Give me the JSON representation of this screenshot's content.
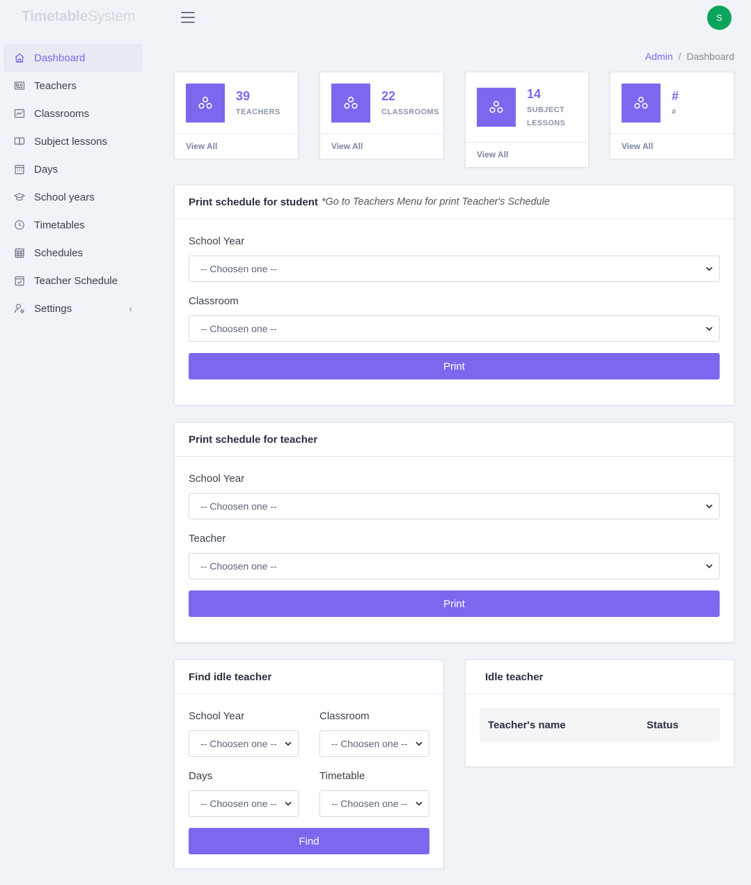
{
  "header": {
    "brand_bold": "Timetable",
    "brand_light": "System",
    "avatar_initial": "S"
  },
  "sidebar": {
    "items": [
      {
        "label": "Dashboard",
        "icon": "home-icon"
      },
      {
        "label": "Teachers",
        "icon": "id-card-icon"
      },
      {
        "label": "Classrooms",
        "icon": "chart-board-icon"
      },
      {
        "label": "Subject lessons",
        "icon": "book-icon"
      },
      {
        "label": "Days",
        "icon": "calendar-icon"
      },
      {
        "label": "School years",
        "icon": "graduation-cap-icon"
      },
      {
        "label": "Timetables",
        "icon": "clock-icon"
      },
      {
        "label": "Schedules",
        "icon": "calendar-grid-icon"
      },
      {
        "label": "Teacher Schedule",
        "icon": "calendar-check-icon"
      },
      {
        "label": "Settings",
        "icon": "user-gear-icon"
      }
    ]
  },
  "breadcrumb": {
    "root": "Admin",
    "separator": "/",
    "current": "Dashboard"
  },
  "stats": [
    {
      "number": "39",
      "label": "TEACHERS",
      "footer": "View All"
    },
    {
      "number": "22",
      "label": "CLASSROOMS",
      "footer": "View All"
    },
    {
      "number": "14",
      "label_line1": "SUBJECT",
      "label_line2": "LESSONS",
      "footer": "View All"
    },
    {
      "number": "#",
      "label": "#",
      "footer": "View All"
    }
  ],
  "student_panel": {
    "title": "Print schedule for student",
    "note": "*Go to Teachers Menu for print Teacher's Schedule",
    "school_year_label": "School Year",
    "school_year_value": "-- Choosen one --",
    "classroom_label": "Classroom",
    "classroom_value": "-- Choosen one --",
    "button": "Print"
  },
  "teacher_panel": {
    "title": "Print schedule for teacher",
    "school_year_label": "School Year",
    "school_year_value": "-- Choosen one --",
    "teacher_label": "Teacher",
    "teacher_value": "-- Choosen one --",
    "button": "Print"
  },
  "idle_panel": {
    "title": "Find idle teacher",
    "school_year_label": "School Year",
    "school_year_value": "-- Choosen one --",
    "classroom_label": "Classroom",
    "classroom_value": "-- Choosen one --",
    "days_label": "Days",
    "days_value": "-- Choosen one --",
    "timetable_label": "Timetable",
    "timetable_value": "-- Choosen one --",
    "button": "Find"
  },
  "idle_result": {
    "title": "Idle teacher",
    "col_name": "Teacher's name",
    "col_status": "Status"
  },
  "colors": {
    "accent": "#7b68ee",
    "avatar": "#0aa45a",
    "background": "#f0f3f8"
  }
}
